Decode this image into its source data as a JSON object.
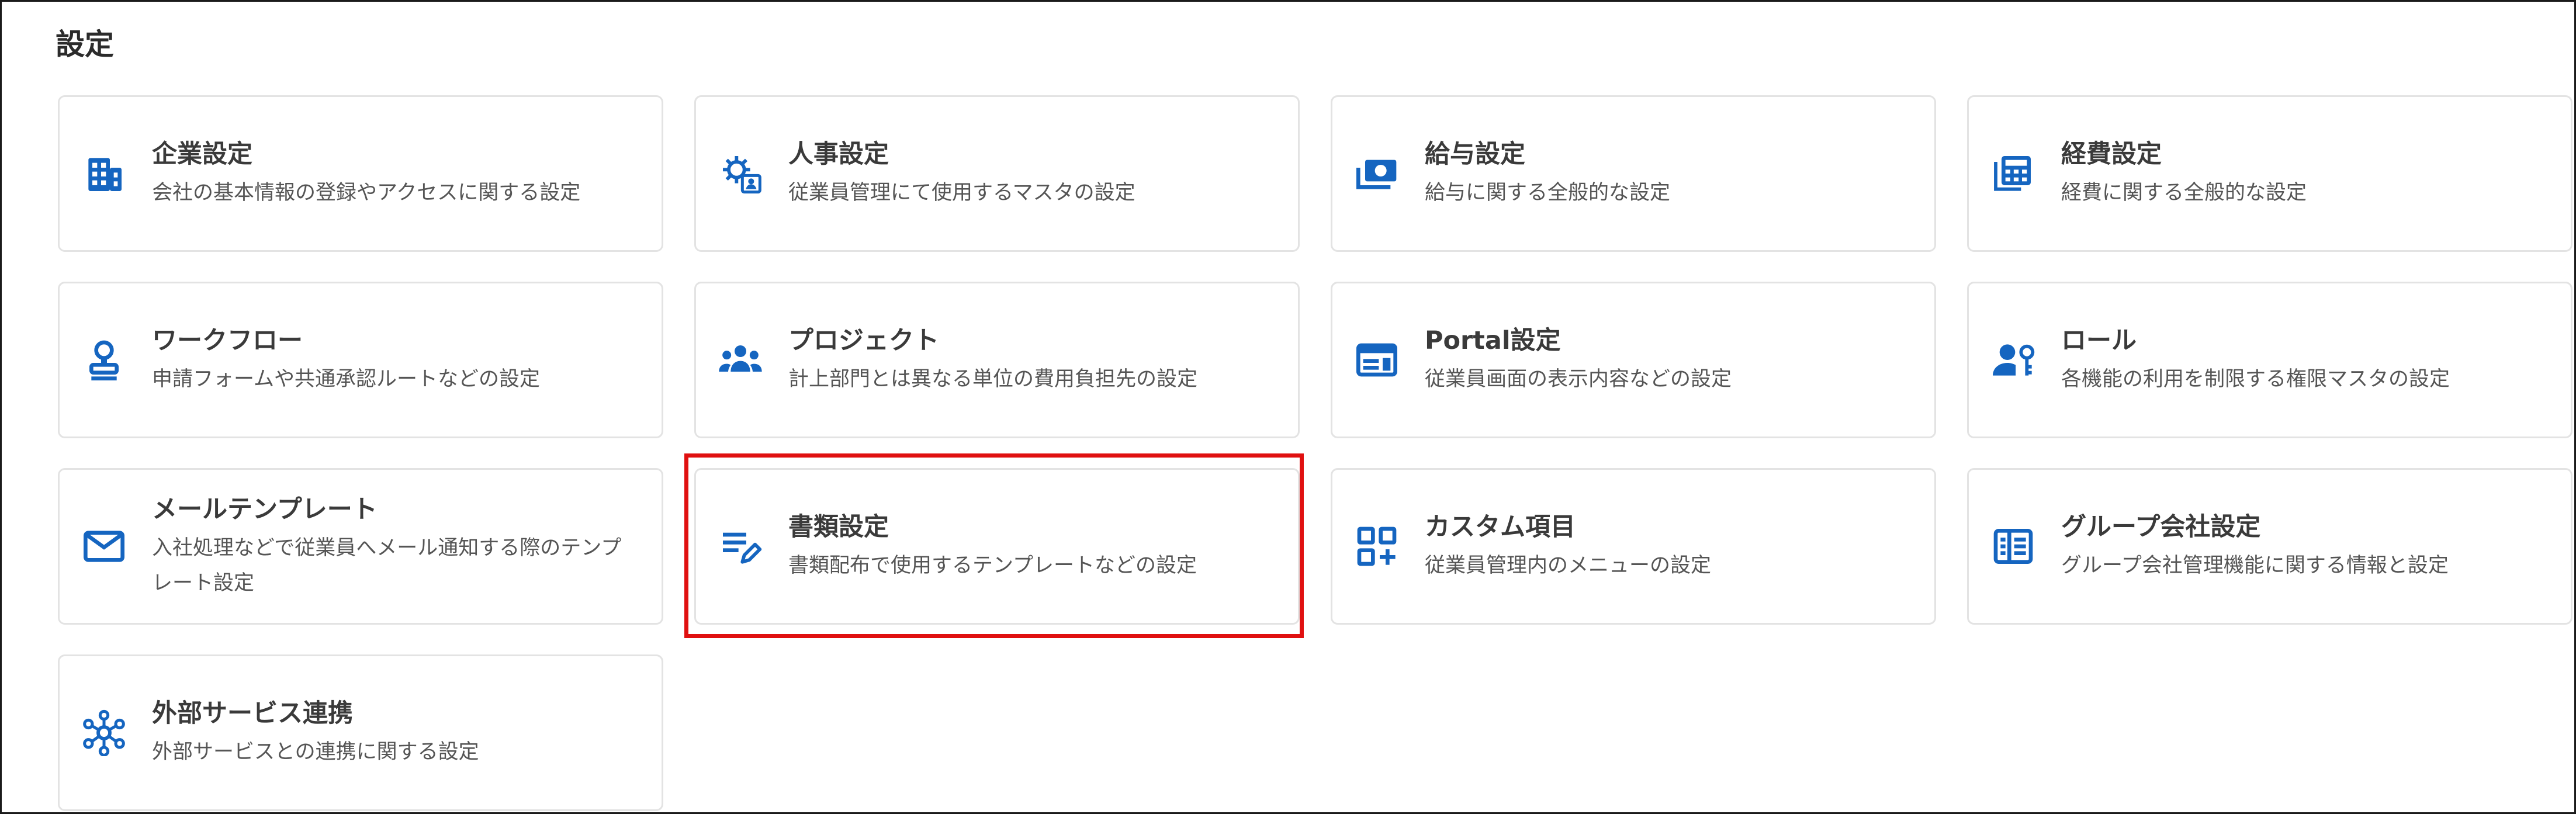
{
  "page": {
    "title": "設定"
  },
  "colors": {
    "icon": "#1565c0",
    "highlight": "#e01010",
    "card_border": "#e3e3e3"
  },
  "cards": [
    {
      "title": "企業設定",
      "desc": "会社の基本情報の登録やアクセスに関する設定",
      "icon": "building-icon"
    },
    {
      "title": "人事設定",
      "desc": "従業員管理にて使用するマスタの設定",
      "icon": "people-gear-icon"
    },
    {
      "title": "給与設定",
      "desc": "給与に関する全般的な設定",
      "icon": "payments-icon"
    },
    {
      "title": "経費設定",
      "desc": "経費に関する全般的な設定",
      "icon": "calculator-icon"
    },
    {
      "title": "ワークフロー",
      "desc": "申請フォームや共通承認ルートなどの設定",
      "icon": "stamp-icon"
    },
    {
      "title": "プロジェクト",
      "desc": "計上部門とは異なる単位の費用負担先の設定",
      "icon": "groups-icon"
    },
    {
      "title": "Portal設定",
      "desc": "従業員画面の表示内容などの設定",
      "icon": "portal-icon"
    },
    {
      "title": "ロール",
      "desc": "各機能の利用を制限する権限マスタの設定",
      "icon": "person-key-icon"
    },
    {
      "title": "メールテンプレート",
      "desc": "入社処理などで従業員へメール通知する際のテンプレート設定",
      "icon": "mail-icon"
    },
    {
      "title": "書類設定",
      "desc": "書類配布で使用するテンプレートなどの設定",
      "icon": "edit-note-icon"
    },
    {
      "title": "カスタム項目",
      "desc": "従業員管理内のメニューの設定",
      "icon": "add-grid-icon"
    },
    {
      "title": "グループ会社設定",
      "desc": "グループ会社管理機能に関する情報と設定",
      "icon": "group-company-icon"
    },
    {
      "title": "外部サービス連携",
      "desc": "外部サービスとの連携に関する設定",
      "icon": "hub-icon"
    }
  ]
}
